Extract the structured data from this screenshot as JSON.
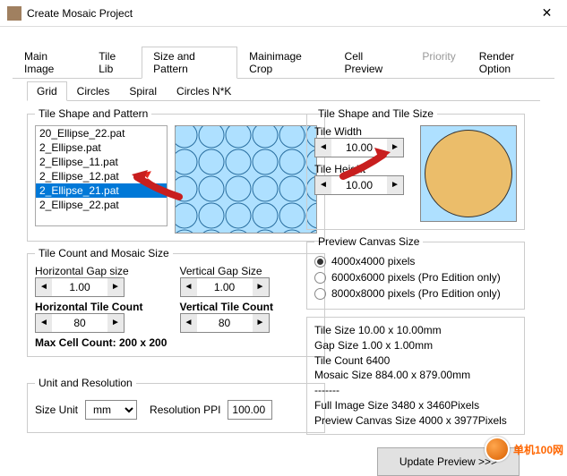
{
  "window": {
    "title": "Create Mosaic Project"
  },
  "tabs": {
    "main_image": "Main Image",
    "tile_lib": "Tile Lib",
    "size_pattern": "Size and Pattern",
    "mainimage_crop": "Mainimage Crop",
    "cell_preview": "Cell Preview",
    "priority": "Priority",
    "render_option": "Render Option"
  },
  "subtabs": {
    "grid": "Grid",
    "circles": "Circles",
    "spiral": "Spiral",
    "circles_nk": "Circles N*K"
  },
  "shape_pattern": {
    "legend": "Tile Shape and Pattern",
    "items": [
      "20_Ellipse_22.pat",
      "2_Ellipse.pat",
      "2_Ellipse_11.pat",
      "2_Ellipse_12.pat",
      "2_Ellipse_21.pat",
      "2_Ellipse_22.pat"
    ],
    "selected_index": 4
  },
  "count_size": {
    "legend": "Tile Count and Mosaic Size",
    "hgap_label": "Horizontal Gap size",
    "vgap_label": "Vertical Gap Size",
    "hgap": "1.00",
    "vgap": "1.00",
    "hcount_label": "Horizontal Tile Count",
    "vcount_label": "Vertical Tile Count",
    "hcount": "80",
    "vcount": "80",
    "maxcell": "Max Cell Count: 200 x 200"
  },
  "unit_res": {
    "legend": "Unit and Resolution",
    "size_unit_label": "Size Unit",
    "size_unit": "mm",
    "ppi_label": "Resolution PPI",
    "ppi": "100.00"
  },
  "tile_size": {
    "legend": "Tile Shape and Tile Size",
    "width_label": "Tile Width",
    "width": "10.00",
    "height_label": "Tile Height",
    "height": "10.00"
  },
  "canvas": {
    "legend": "Preview Canvas Size",
    "opt1": "4000x4000 pixels",
    "opt2": "6000x6000 pixels (Pro Edition only)",
    "opt3": "8000x8000 pixels (Pro Edition only)"
  },
  "info": {
    "l1": "Tile Size 10.00 x 10.00mm",
    "l2": "Gap Size 1.00 x 1.00mm",
    "l3": "Tile Count 6400",
    "l4": "Mosaic Size 884.00 x 879.00mm",
    "l5": "-------",
    "l6": "Full Image Size 3480 x 3460Pixels",
    "l7": "Preview Canvas Size 4000 x 3977Pixels"
  },
  "update_btn": "Update Preview >>>",
  "watermark": "单机100网"
}
